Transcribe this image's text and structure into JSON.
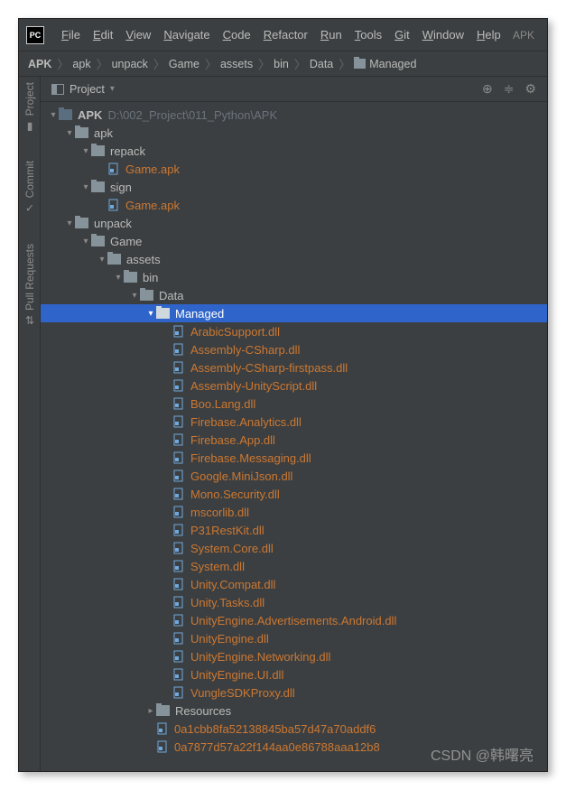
{
  "titlebar": {
    "logo": "PC",
    "menus": [
      "File",
      "Edit",
      "View",
      "Navigate",
      "Code",
      "Refactor",
      "Run",
      "Tools",
      "Git",
      "Window",
      "Help"
    ],
    "right": "APK"
  },
  "breadcrumbs": [
    "APK",
    "apk",
    "unpack",
    "Game",
    "assets",
    "bin",
    "Data",
    "Managed"
  ],
  "gutter": [
    {
      "label": "Project",
      "icon": "folder"
    },
    {
      "label": "Commit",
      "icon": "check"
    },
    {
      "label": "Pull Requests",
      "icon": "pr"
    }
  ],
  "panel": {
    "title": "Project"
  },
  "tree": [
    {
      "d": 0,
      "t": "v",
      "k": "froot",
      "l": "APK",
      "path": "D:\\002_Project\\011_Python\\APK",
      "bold": true
    },
    {
      "d": 1,
      "t": "v",
      "k": "f",
      "l": "apk"
    },
    {
      "d": 2,
      "t": "v",
      "k": "f",
      "l": "repack"
    },
    {
      "d": 3,
      "t": "",
      "k": "file",
      "l": "Game.apk",
      "orange": true
    },
    {
      "d": 2,
      "t": "v",
      "k": "f",
      "l": "sign"
    },
    {
      "d": 3,
      "t": "",
      "k": "file",
      "l": "Game.apk",
      "orange": true
    },
    {
      "d": 1,
      "t": "v",
      "k": "f",
      "l": "unpack"
    },
    {
      "d": 2,
      "t": "v",
      "k": "f",
      "l": "Game"
    },
    {
      "d": 3,
      "t": "v",
      "k": "f",
      "l": "assets"
    },
    {
      "d": 4,
      "t": "v",
      "k": "f",
      "l": "bin"
    },
    {
      "d": 5,
      "t": "v",
      "k": "f",
      "l": "Data"
    },
    {
      "d": 6,
      "t": "v",
      "k": "f",
      "l": "Managed",
      "sel": true
    },
    {
      "d": 7,
      "t": "",
      "k": "file",
      "l": "ArabicSupport.dll",
      "orange": true
    },
    {
      "d": 7,
      "t": "",
      "k": "file",
      "l": "Assembly-CSharp.dll",
      "orange": true
    },
    {
      "d": 7,
      "t": "",
      "k": "file",
      "l": "Assembly-CSharp-firstpass.dll",
      "orange": true
    },
    {
      "d": 7,
      "t": "",
      "k": "file",
      "l": "Assembly-UnityScript.dll",
      "orange": true
    },
    {
      "d": 7,
      "t": "",
      "k": "file",
      "l": "Boo.Lang.dll",
      "orange": true
    },
    {
      "d": 7,
      "t": "",
      "k": "file",
      "l": "Firebase.Analytics.dll",
      "orange": true
    },
    {
      "d": 7,
      "t": "",
      "k": "file",
      "l": "Firebase.App.dll",
      "orange": true
    },
    {
      "d": 7,
      "t": "",
      "k": "file",
      "l": "Firebase.Messaging.dll",
      "orange": true
    },
    {
      "d": 7,
      "t": "",
      "k": "file",
      "l": "Google.MiniJson.dll",
      "orange": true
    },
    {
      "d": 7,
      "t": "",
      "k": "file",
      "l": "Mono.Security.dll",
      "orange": true
    },
    {
      "d": 7,
      "t": "",
      "k": "file",
      "l": "mscorlib.dll",
      "orange": true
    },
    {
      "d": 7,
      "t": "",
      "k": "file",
      "l": "P31RestKit.dll",
      "orange": true
    },
    {
      "d": 7,
      "t": "",
      "k": "file",
      "l": "System.Core.dll",
      "orange": true
    },
    {
      "d": 7,
      "t": "",
      "k": "file",
      "l": "System.dll",
      "orange": true
    },
    {
      "d": 7,
      "t": "",
      "k": "file",
      "l": "Unity.Compat.dll",
      "orange": true
    },
    {
      "d": 7,
      "t": "",
      "k": "file",
      "l": "Unity.Tasks.dll",
      "orange": true
    },
    {
      "d": 7,
      "t": "",
      "k": "file",
      "l": "UnityEngine.Advertisements.Android.dll",
      "orange": true
    },
    {
      "d": 7,
      "t": "",
      "k": "file",
      "l": "UnityEngine.dll",
      "orange": true
    },
    {
      "d": 7,
      "t": "",
      "k": "file",
      "l": "UnityEngine.Networking.dll",
      "orange": true
    },
    {
      "d": 7,
      "t": "",
      "k": "file",
      "l": "UnityEngine.UI.dll",
      "orange": true
    },
    {
      "d": 7,
      "t": "",
      "k": "file",
      "l": "VungleSDKProxy.dll",
      "orange": true
    },
    {
      "d": 6,
      "t": ">",
      "k": "f",
      "l": "Resources"
    },
    {
      "d": 6,
      "t": "",
      "k": "file",
      "l": "0a1cbb8fa52138845ba57d47a70addf6",
      "orange": true
    },
    {
      "d": 6,
      "t": "",
      "k": "file",
      "l": "0a7877d57a22f144aa0e86788aaa12b8",
      "orange": true
    }
  ],
  "watermark": "CSDN @韩曙亮"
}
